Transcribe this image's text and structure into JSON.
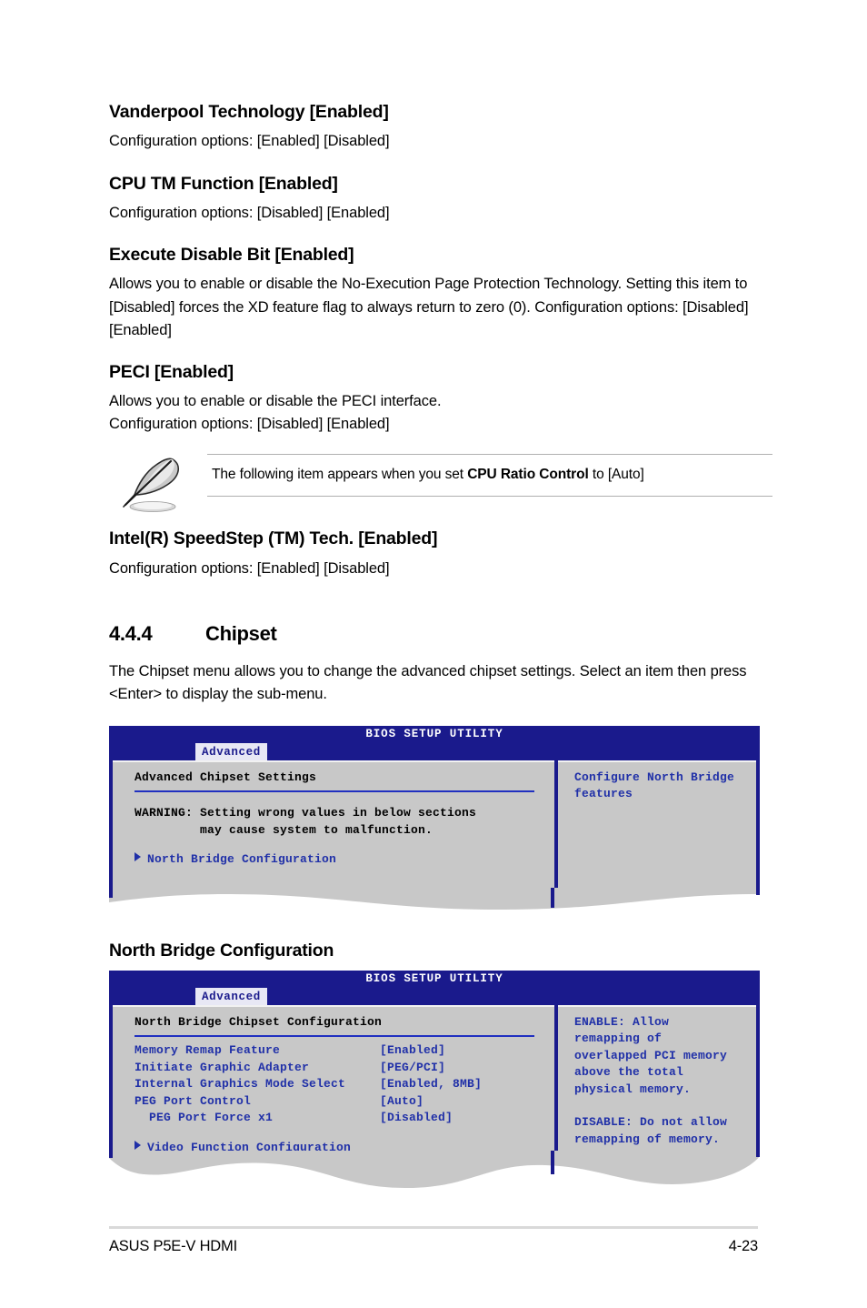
{
  "document": {
    "footer_left": "ASUS P5E-V HDMI",
    "footer_right": "4-23"
  },
  "items": [
    {
      "heading": "Vanderpool Technology [Enabled]",
      "body": "Configuration options: [Enabled] [Disabled]"
    },
    {
      "heading": "CPU TM Function [Enabled]",
      "body": "Configuration options: [Disabled] [Enabled]"
    },
    {
      "heading": "Execute Disable Bit [Enabled]",
      "body": "Allows you to enable or disable the No-Execution Page Protection Technology. Setting this item to [Disabled] forces the XD feature flag to always return to zero (0). Configuration options: [Disabled] [Enabled]"
    },
    {
      "heading": "PECI [Enabled]",
      "body": "Allows you to enable or disable the PECI interface.\nConfiguration options: [Disabled] [Enabled]"
    },
    {
      "heading": "Intel(R) SpeedStep (TM) Tech. [Enabled]",
      "body": "Configuration options: [Enabled] [Disabled]"
    }
  ],
  "note": {
    "icon": "feather-pen-icon",
    "text_before": "The following item appears when you set ",
    "text_bold": "CPU Ratio Control",
    "text_after": " to [Auto]"
  },
  "section": {
    "number": "4.4.4",
    "title": "Chipset",
    "intro": "The Chipset menu allows you to change the advanced chipset settings. Select an item then press <Enter> to display the sub-menu."
  },
  "subsection": {
    "title": "North Bridge Configuration"
  },
  "bios_screen_1": {
    "title": "BIOS SETUP UTILITY",
    "tab": "Advanced",
    "panel_heading": "Advanced Chipset Settings",
    "warning_line_1": "WARNING: Setting wrong values in below sections",
    "warning_line_2": "         may cause system to malfunction.",
    "submenu": "North Bridge Configuration",
    "help_line_1": "Configure North Bridge",
    "help_line_2": "features"
  },
  "bios_screen_2": {
    "title": "BIOS SETUP UTILITY",
    "tab": "Advanced",
    "panel_heading": "North Bridge Chipset Configuration",
    "settings": [
      {
        "label": "Memory Remap Feature",
        "value": "[Enabled]"
      },
      {
        "label": "Initiate Graphic Adapter",
        "value": "[PEG/PCI]"
      },
      {
        "label": "Internal Graphics Mode Select",
        "value": "[Enabled, 8MB]"
      },
      {
        "label": "PEG Port Control",
        "value": "[Auto]"
      },
      {
        "label": "  PEG Port Force x1",
        "value": "[Disabled]"
      }
    ],
    "submenu": "Video Function Configuration",
    "help_lines": [
      "ENABLE: Allow",
      "remapping of",
      "overlapped PCI memory",
      "above the total",
      "physical memory.",
      "",
      "DISABLE: Do not allow",
      "remapping of memory."
    ]
  },
  "colors": {
    "bios_blue": "#1a1a8c",
    "bios_gray": "#c8c8c8",
    "bios_text_blue": "#2030a8",
    "rule_gray": "#d9d9d9"
  }
}
